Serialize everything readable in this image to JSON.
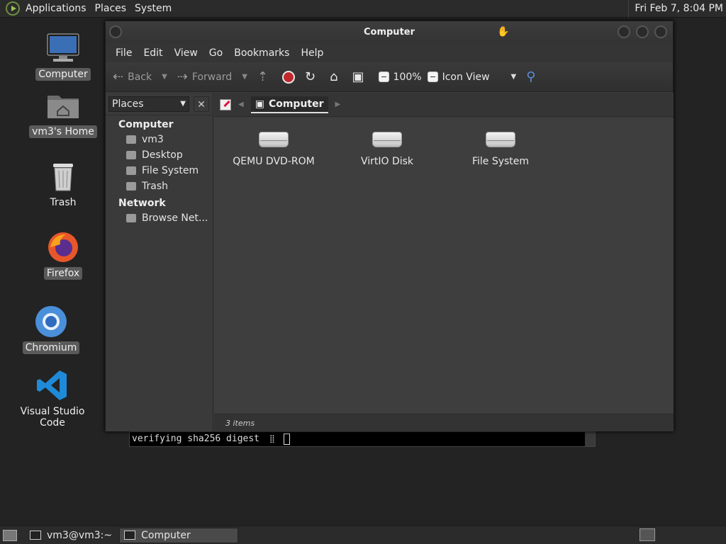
{
  "top_panel": {
    "menus": [
      "Applications",
      "Places",
      "System"
    ],
    "clock": "Fri Feb  7,  8:04 PM"
  },
  "desktop": {
    "icons": [
      {
        "label": "Computer"
      },
      {
        "label": "vm3's Home"
      },
      {
        "label": "Trash"
      },
      {
        "label": "Firefox"
      },
      {
        "label": "Chromium"
      },
      {
        "label": "Visual Studio Code"
      }
    ]
  },
  "terminal": {
    "text": "verifying sha256 digest"
  },
  "window": {
    "title": "Computer",
    "menu": [
      "File",
      "Edit",
      "View",
      "Go",
      "Bookmarks",
      "Help"
    ],
    "toolbar": {
      "back": "Back",
      "forward": "Forward",
      "zoom": "100%",
      "view_mode": "Icon View"
    },
    "sidebar": {
      "selector": "Places",
      "close": "✕",
      "groups": [
        {
          "title": "Computer",
          "items": [
            "vm3",
            "Desktop",
            "File System",
            "Trash"
          ]
        },
        {
          "title": "Network",
          "items": [
            "Browse Net..."
          ]
        }
      ]
    },
    "pathbar": {
      "current": "Computer"
    },
    "content": {
      "items": [
        "QEMU DVD-ROM",
        "VirtIO Disk",
        "File System"
      ]
    },
    "status": "3 items"
  },
  "bottom_panel": {
    "tasks": [
      "vm3@vm3:~",
      "Computer"
    ]
  }
}
